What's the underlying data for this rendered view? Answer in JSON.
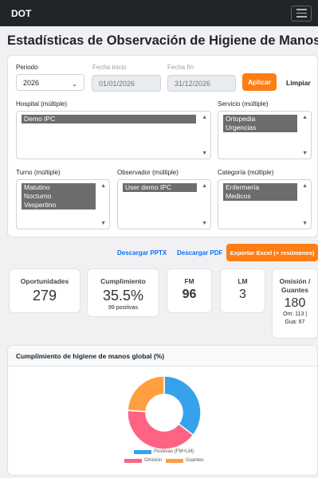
{
  "nav": {
    "brand": "DOT"
  },
  "page": {
    "title": "Estadísticas de Observación de Higiene de Manos"
  },
  "filters": {
    "periodo": {
      "label": "Periodo",
      "value": "2026"
    },
    "fecha_inicio": {
      "label": "Fecha inicio",
      "value": "01/01/2026"
    },
    "fecha_fin": {
      "label": "Fecha fin",
      "value": "31/12/2026"
    },
    "aplicar_label": "Aplicar",
    "limpiar_label": "Limpiar",
    "hospital": {
      "label": "Hospital (múltiple)",
      "options": [
        "Demo IPC"
      ]
    },
    "servicio": {
      "label": "Servicio (múltiple)",
      "options": [
        "Ortopedia",
        "Urgencias"
      ]
    },
    "turno": {
      "label": "Turno (múltiple)",
      "options": [
        "Matutino",
        "Nocturno",
        "Vespertino"
      ]
    },
    "observador": {
      "label": "Observador (múltiple)",
      "options": [
        "User demo IPC"
      ]
    },
    "categoria": {
      "label": "Categoría (múltiple)",
      "options": [
        "Enfermería",
        "Medicos"
      ]
    }
  },
  "actions": {
    "pptx_label": "Descargar PPTX",
    "pdf_label": "Descargar PDF",
    "excel_label": "Exportar Excel (+ resúmenes)"
  },
  "kpis": {
    "oportunidades": {
      "title": "Oportunidades",
      "value": "279"
    },
    "cumplimiento": {
      "title": "Cumplimiento",
      "value": "35.5%",
      "sub": "99 positivas"
    },
    "fm": {
      "title": "FM",
      "value": "96"
    },
    "lm": {
      "title": "LM",
      "value": "3"
    },
    "omision": {
      "title_1": "Omisión /",
      "title_2": "Guantes",
      "value": "180",
      "sub_1": "Om: 113 |",
      "sub_2": "Gua: 67"
    }
  },
  "chart": {
    "title": "Cumplimiento de higiene de manos global (%)"
  },
  "chart_data": {
    "type": "pie",
    "categories": [
      "Positivas (FM+LM)",
      "Omisión",
      "Guantes"
    ],
    "values": [
      99,
      113,
      67
    ],
    "colors": [
      "#36a2eb",
      "#ff6384",
      "#ff9f40"
    ],
    "donut": true,
    "legend": "bottom"
  }
}
